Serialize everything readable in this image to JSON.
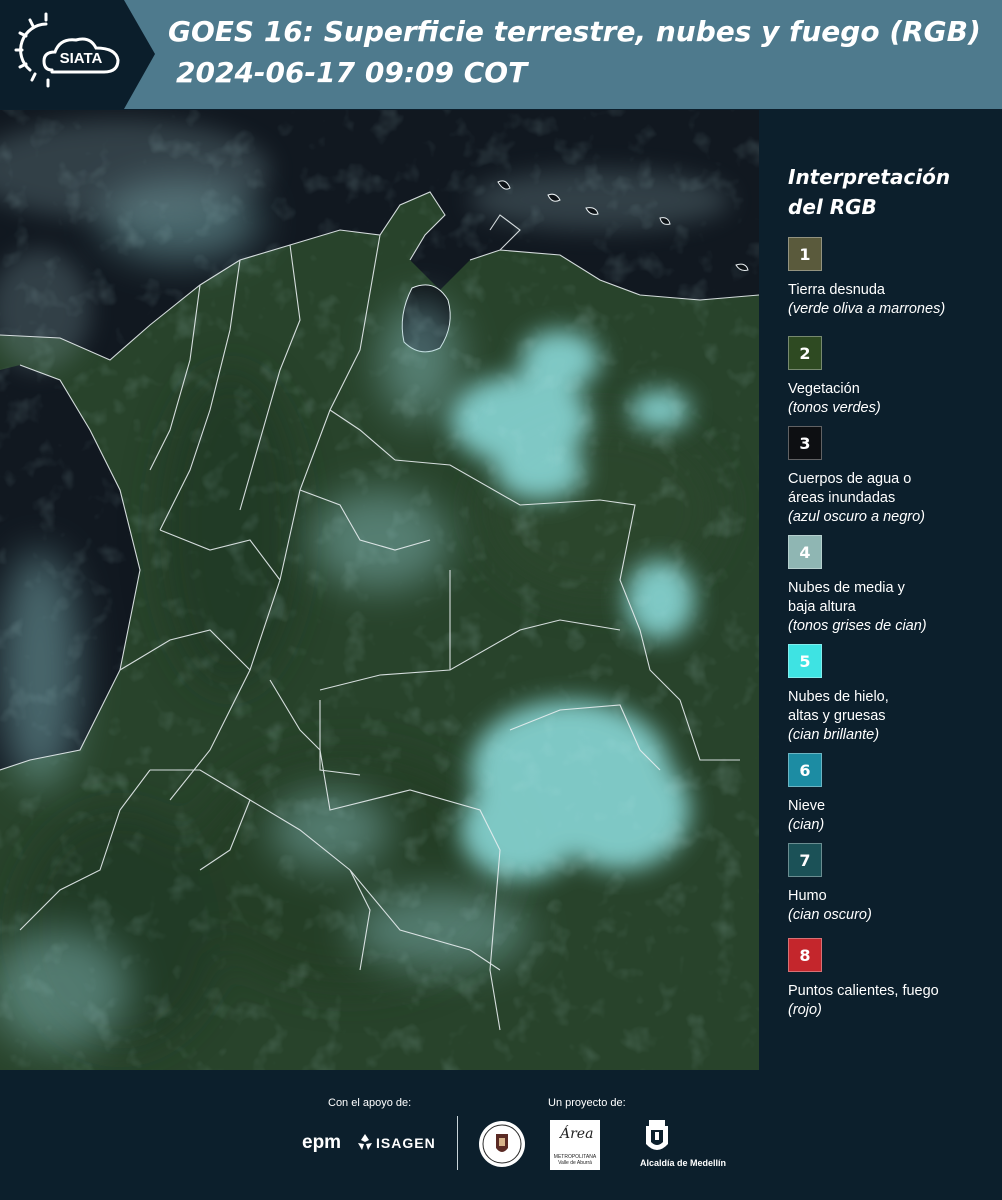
{
  "header": {
    "logo_text": "SIATA",
    "title_line1": "GOES 16: Superficie terrestre, nubes y fuego (RGB)",
    "title_line2": "2024-06-17 09:09 COT"
  },
  "legend": {
    "title_line1": "Interpretación",
    "title_line2": "del RGB",
    "items": [
      {
        "number": "1",
        "label_lines": [
          "Tierra desnuda"
        ],
        "note": "(verde oliva a marrones)",
        "color": "#5a5a3c"
      },
      {
        "number": "2",
        "label_lines": [
          "Vegetación"
        ],
        "note": "(tonos verdes)",
        "color": "#2e4a22"
      },
      {
        "number": "3",
        "label_lines": [
          "Cuerpos de agua o",
          "áreas inundadas"
        ],
        "note": "(azul oscuro a negro)",
        "color": "#0d0f12"
      },
      {
        "number": "4",
        "label_lines": [
          "Nubes de media y",
          "baja altura"
        ],
        "note": "(tonos grises de cian)",
        "color": "#8fb6b3"
      },
      {
        "number": "5",
        "label_lines": [
          "Nubes de hielo,",
          "altas y gruesas"
        ],
        "note": "(cian brillante)",
        "color": "#3ee3e3"
      },
      {
        "number": "6",
        "label_lines": [
          "Nieve"
        ],
        "note": "(cian)",
        "color": "#1c8ca3"
      },
      {
        "number": "7",
        "label_lines": [
          "Humo"
        ],
        "note": "(cian oscuro)",
        "color": "#1b5157"
      },
      {
        "number": "8",
        "label_lines": [
          "Puntos calientes, fuego"
        ],
        "note": "(rojo)",
        "color": "#c4262c"
      }
    ]
  },
  "footer": {
    "support_label": "Con el apoyo de:",
    "project_label": "Un proyecto de:",
    "epm": "epm",
    "isagen": "ISAGEN",
    "amva_word": "Área",
    "amva_caption": "METROPOLITANA Valle de Aburrá",
    "alcaldia": "Alcaldía de Medellín"
  },
  "colors": {
    "header_bg": "#4e7a8d",
    "logo_bg": "#0b1e2b",
    "page_bg": "#0c1f2c",
    "ocean": "#111820",
    "land": "#28432b",
    "cloud_cyan": "#8ee0e0",
    "border_lines": "#e8eef0"
  }
}
